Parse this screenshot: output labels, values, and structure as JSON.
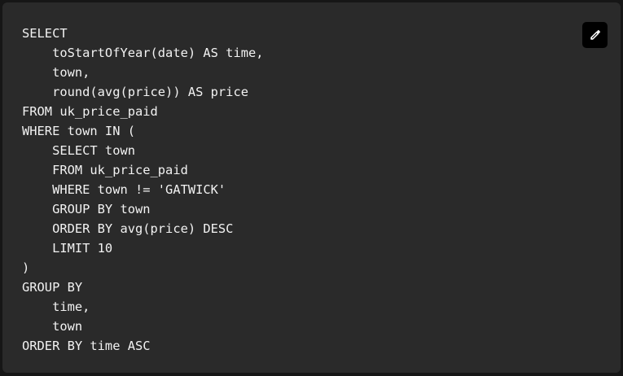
{
  "code": {
    "lines": [
      "SELECT",
      "    toStartOfYear(date) AS time,",
      "    town,",
      "    round(avg(price)) AS price",
      "FROM uk_price_paid",
      "WHERE town IN (",
      "    SELECT town",
      "    FROM uk_price_paid",
      "    WHERE town != 'GATWICK'",
      "    GROUP BY town",
      "    ORDER BY avg(price) DESC",
      "    LIMIT 10",
      ")",
      "GROUP BY",
      "    time,",
      "    town",
      "ORDER BY time ASC"
    ]
  },
  "toolbar": {
    "edit_icon": "pencil-icon"
  },
  "colors": {
    "page_background": "#161616",
    "card_background": "#2a2a2a",
    "code_text": "#f2f2f2",
    "button_background": "#000000",
    "icon_color": "#ffffff"
  }
}
